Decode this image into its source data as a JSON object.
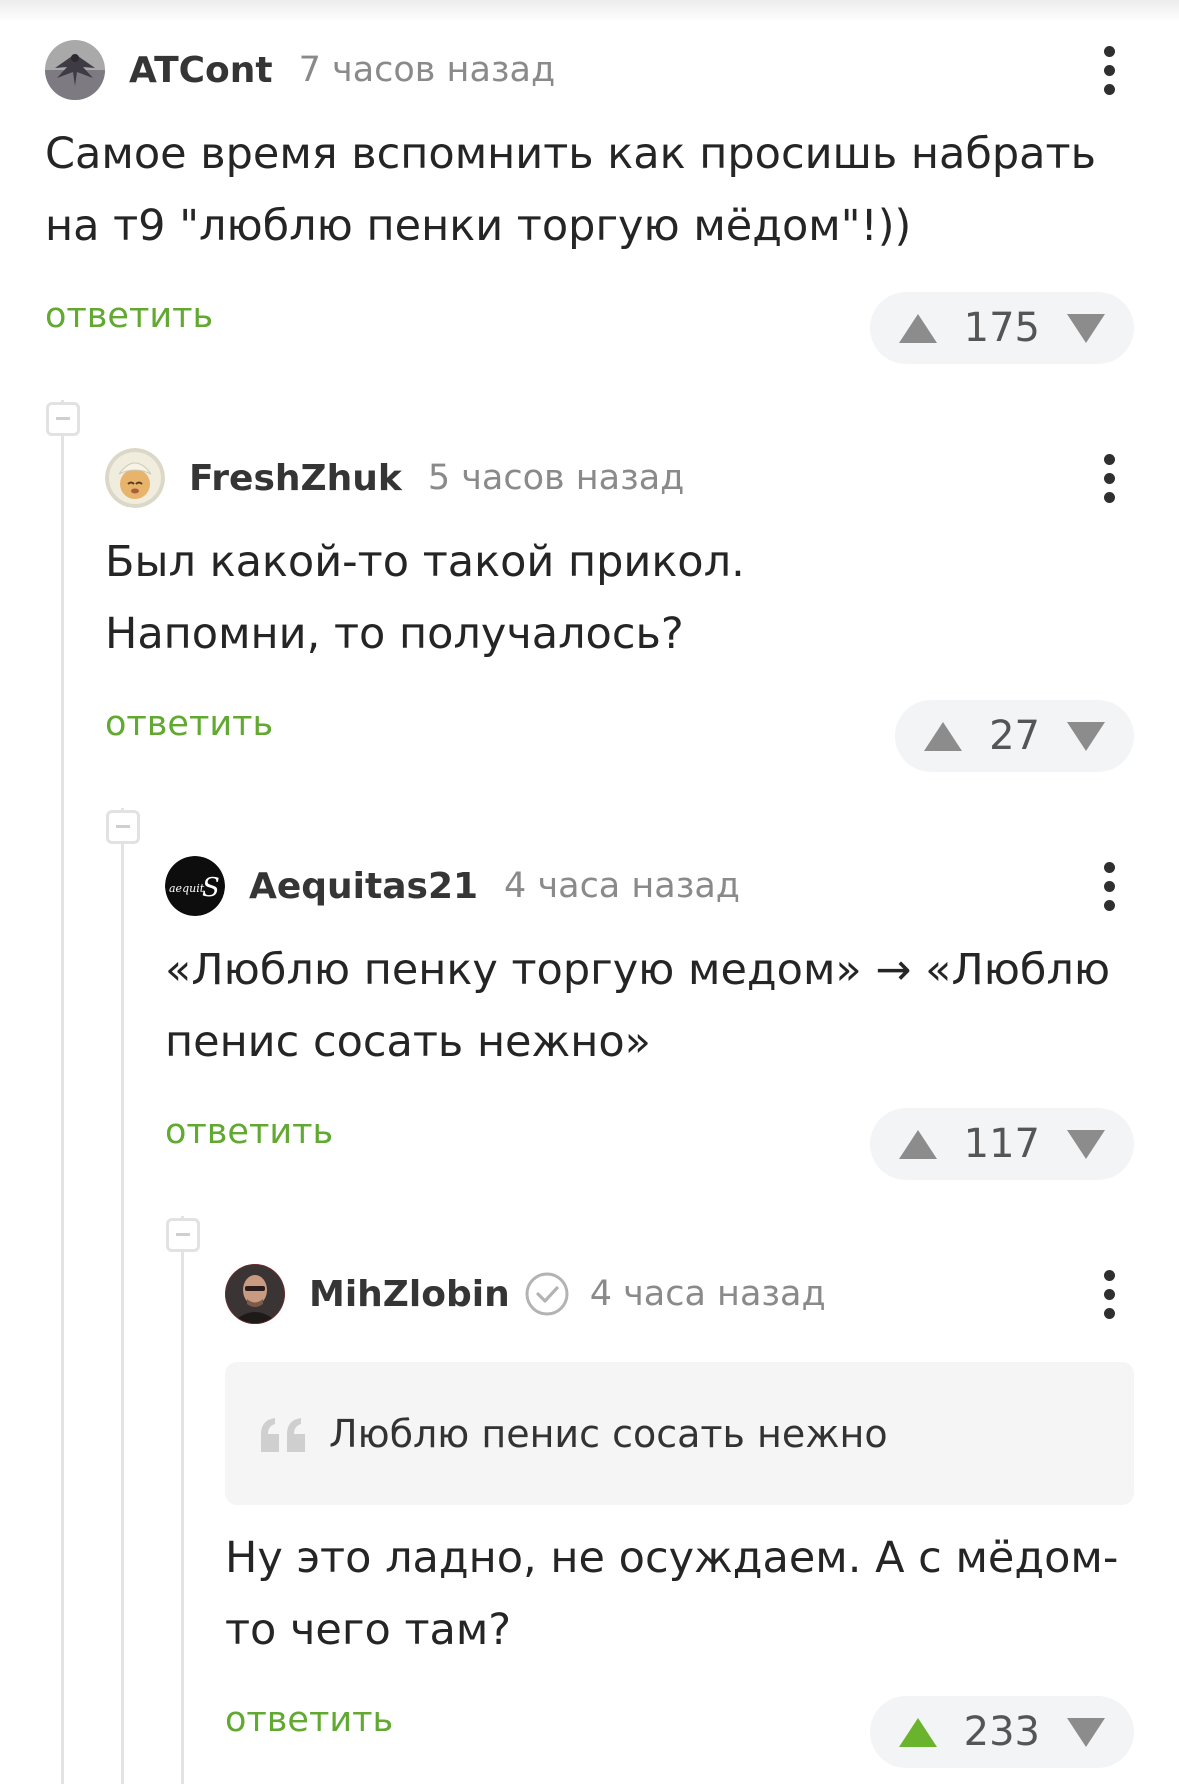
{
  "comments": [
    {
      "username": "ATCont",
      "time": "7 часов назад",
      "avatar": "winged-figure-avatar",
      "verified": false,
      "quote": null,
      "lines": [
        "Самое время вспомнить как просишь набрать",
        "на т9 \"люблю пенки торгую мёдом\"!))"
      ],
      "reply": "ответить",
      "score": "175",
      "upvoted": false
    },
    {
      "username": "FreshZhuk",
      "time": "5 часов назад",
      "avatar": "cartoon-face-avatar",
      "verified": false,
      "quote": null,
      "lines": [
        "Был какой-то такой прикол.",
        "Напомни, то получалось?"
      ],
      "reply": "ответить",
      "score": "27",
      "upvoted": false
    },
    {
      "username": "Aequitas21",
      "time": "4 часа назад",
      "avatar": "aequitas-logo-avatar",
      "verified": false,
      "quote": null,
      "lines": [
        "«Люблю пенку торгую медом» → «Люблю",
        "пенис сосать нежно»"
      ],
      "reply": "ответить",
      "score": "117",
      "upvoted": false
    },
    {
      "username": "MihZlobin",
      "time": "4 часа назад",
      "avatar": "man-portrait-avatar",
      "verified": true,
      "quote": "Люблю пенис сосать нежно",
      "lines": [
        "Ну это ладно, не осуждаем. А с мёдом-",
        "то чего там?"
      ],
      "reply": "ответить",
      "score": "233",
      "upvoted": true
    }
  ],
  "colors": {
    "reply_green": "#61a931",
    "upvote_active": "#6ab42d",
    "vote_inactive": "#8c8c8c",
    "rating_bg": "#f3f4f6",
    "thread_line": "#e3e3e3"
  }
}
